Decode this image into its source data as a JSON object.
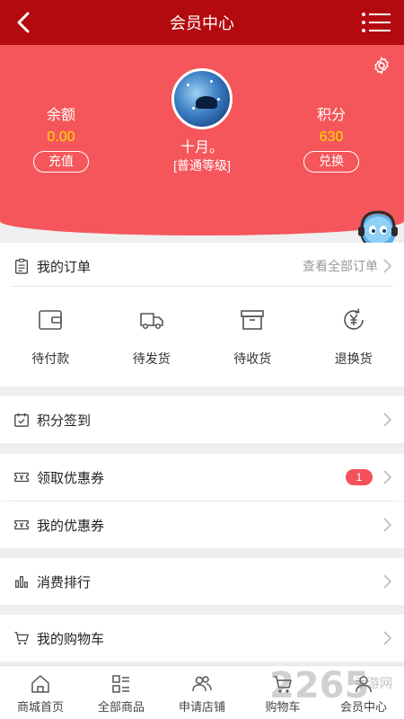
{
  "header": {
    "title": "会员中心"
  },
  "profile": {
    "balance_label": "余额",
    "balance_value": "0.00",
    "recharge_label": "充值",
    "points_label": "积分",
    "points_value": "630",
    "redeem_label": "兑换",
    "nickname": "十月。",
    "level": "[普通等级]"
  },
  "orders": {
    "title": "我的订单",
    "view_all": "查看全部订单",
    "items": [
      {
        "label": "待付款",
        "icon": "wallet-icon"
      },
      {
        "label": "待发货",
        "icon": "truck-icon"
      },
      {
        "label": "待收货",
        "icon": "box-icon"
      },
      {
        "label": "退换货",
        "icon": "yen-refresh-icon"
      }
    ]
  },
  "menu": {
    "checkin": "积分签到",
    "get_coupons": "领取优惠券",
    "coupon_badge": "1",
    "my_coupons": "我的优惠券",
    "ranking": "消费排行",
    "my_cart": "我的购物车"
  },
  "tabbar": [
    {
      "label": "商城首页",
      "icon": "home-icon"
    },
    {
      "label": "全部商品",
      "icon": "grid-list-icon"
    },
    {
      "label": "申请店铺",
      "icon": "users-icon"
    },
    {
      "label": "购物车",
      "icon": "cart-icon"
    },
    {
      "label": "会员中心",
      "icon": "user-icon"
    }
  ],
  "watermark": {
    "brand": "2265",
    "sub": "手游网"
  },
  "colors": {
    "header": "#b30a0f",
    "hero": "#f5565b",
    "accent": "#ffde00",
    "badge": "#f4515a"
  }
}
